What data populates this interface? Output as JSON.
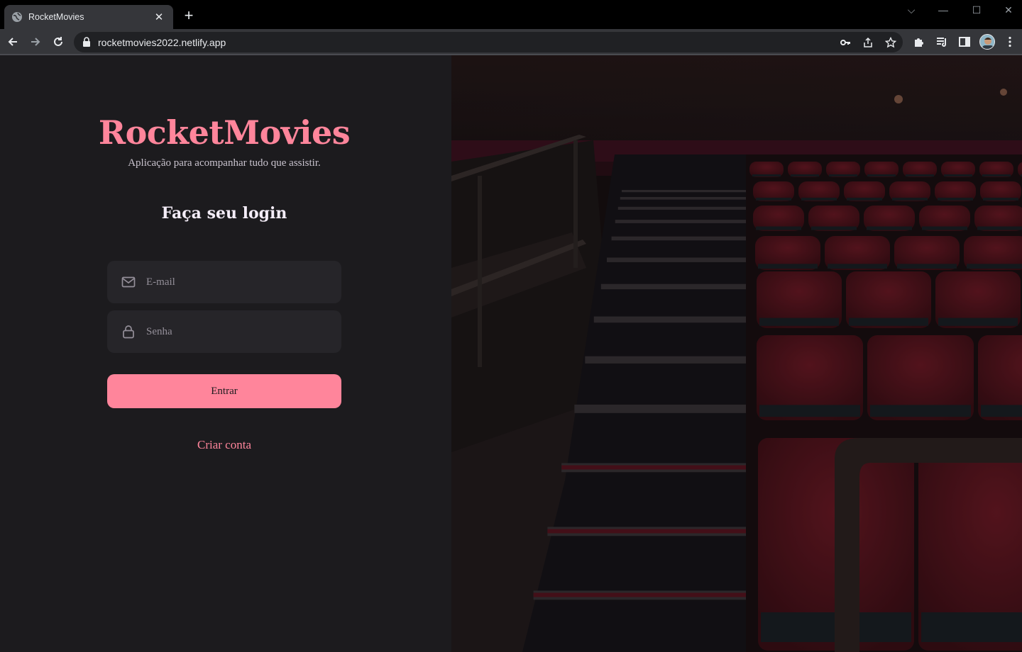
{
  "browser": {
    "tab_title": "RocketMovies",
    "tab_close": "✕",
    "new_tab": "+",
    "url": "rocketmovies2022.netlify.app",
    "window_controls": {
      "minimize": "—",
      "maximize": "☐",
      "close": "✕",
      "tab_search": "⌵"
    }
  },
  "brand": {
    "name": "RocketMovies",
    "tagline": "Aplicação para acompanhar tudo que assistir."
  },
  "form": {
    "heading": "Faça seu login",
    "email_placeholder": "E-mail",
    "password_placeholder": "Senha",
    "submit_label": "Entrar",
    "create_account_label": "Criar conta"
  },
  "colors": {
    "accent": "#ff859b",
    "background": "#1c1b1e",
    "input_background": "#262529",
    "heading_text": "#f4edf8",
    "muted_text": "#948f99"
  },
  "icons": {
    "email": "mail-icon",
    "password": "lock-icon",
    "hero": "cinema-seats-image"
  }
}
